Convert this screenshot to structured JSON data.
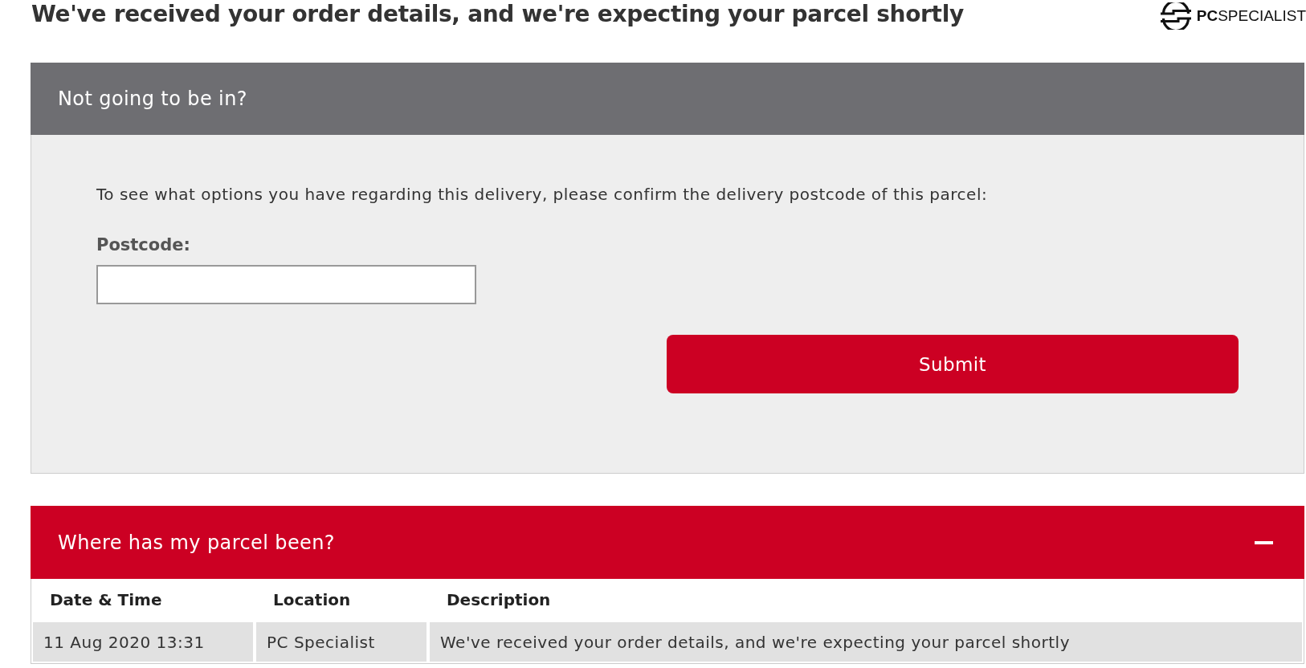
{
  "header": {
    "title": "We've received your order details, and we're expecting your parcel shortly",
    "logo_text": "**PC**SPECIALIST"
  },
  "reschedule_panel": {
    "title": "Not going to be in?",
    "instructions": "To see what options you have regarding this delivery, please confirm the delivery postcode of this parcel:",
    "postcode_field": {
      "label": "Postcode:"
    },
    "submit_button": "Submit"
  },
  "history_panel": {
    "title": "Where has my parcel been?",
    "expanded": true,
    "table": {
      "columns": [
        "Date & Time",
        "Location",
        "Description"
      ],
      "rows": [
        [
          "11 Aug 2020 13:31",
          "PC Specialist",
          "We've received your order details, and we're expecting your parcel shortly"
        ]
      ]
    }
  }
}
